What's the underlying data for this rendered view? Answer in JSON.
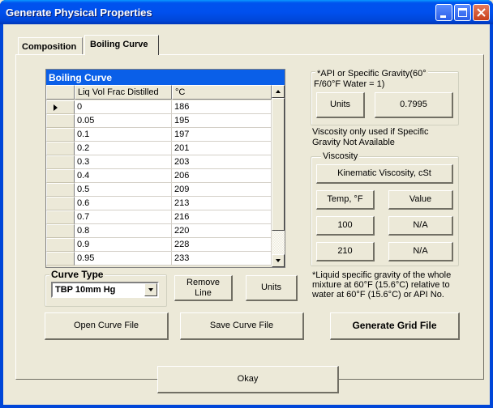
{
  "window": {
    "title": "Generate Physical Properties",
    "controls": [
      "minimize",
      "maximize",
      "close"
    ]
  },
  "tabs": [
    {
      "label": "Composition",
      "active": false
    },
    {
      "label": "Boiling Curve",
      "active": true
    }
  ],
  "grid": {
    "caption": "Boiling Curve",
    "columns": [
      "Liq Vol Frac Distilled",
      "°C"
    ],
    "current_row": 0,
    "rows": [
      [
        "0",
        "186"
      ],
      [
        "0.05",
        "195"
      ],
      [
        "0.1",
        "197"
      ],
      [
        "0.2",
        "201"
      ],
      [
        "0.3",
        "203"
      ],
      [
        "0.4",
        "206"
      ],
      [
        "0.5",
        "209"
      ],
      [
        "0.6",
        "213"
      ],
      [
        "0.7",
        "216"
      ],
      [
        "0.8",
        "220"
      ],
      [
        "0.9",
        "228"
      ],
      [
        "0.95",
        "233"
      ]
    ]
  },
  "curve_type": {
    "label": "Curve Type",
    "selected": "TBP 10mm Hg"
  },
  "buttons": {
    "remove_line_1": "Remove",
    "remove_line_2": "Line",
    "units": "Units",
    "open_curve": "Open Curve File",
    "save_curve": "Save Curve File",
    "generate_grid": "Generate Grid File",
    "okay": "Okay"
  },
  "gravity": {
    "label_1": "*API or Specific Gravity(60°",
    "label_2": "F/60°F Water = 1)",
    "units": "Units",
    "value": "0.7995"
  },
  "viscosity_note": {
    "line1": "Viscosity only used if Specific",
    "line2": "Gravity  Not Available"
  },
  "viscosity": {
    "label": "Viscosity",
    "type": "Kinematic Viscosity, cSt",
    "temp_header": "Temp, °F",
    "value_header": "Value",
    "rows": [
      {
        "temp": "100",
        "value": "N/A"
      },
      {
        "temp": "210",
        "value": "N/A"
      }
    ]
  },
  "footnote": {
    "line1": "*Liquid specific gravity of the whole",
    "line2": "mixture at 60°F (15.6°C) relative to",
    "line3": "water at 60°F (15.6°C) or API No."
  }
}
